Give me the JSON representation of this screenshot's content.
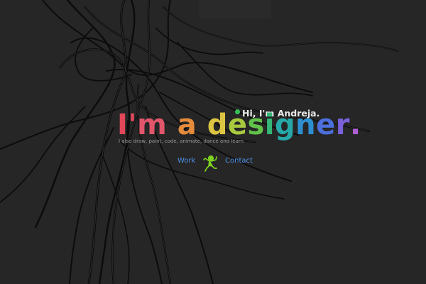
{
  "hero": {
    "greeting": "Hi, I'm Andreja.",
    "headline_letters": [
      {
        "char": "I",
        "color": "#e0485a"
      },
      {
        "char": "'",
        "color": "#e0485a"
      },
      {
        "char": "m",
        "color": "#e1566b"
      },
      {
        "char": " ",
        "color": "#ffffff"
      },
      {
        "char": "a",
        "color": "#e58b3c"
      },
      {
        "char": " ",
        "color": "#ffffff"
      },
      {
        "char": "d",
        "color": "#dcc542"
      },
      {
        "char": "e",
        "color": "#a9c93f"
      },
      {
        "char": "s",
        "color": "#62c34a"
      },
      {
        "char": "i",
        "color": "#34b676"
      },
      {
        "char": "g",
        "color": "#27a8a8"
      },
      {
        "char": "n",
        "color": "#2d8fd0"
      },
      {
        "char": "e",
        "color": "#4c6fdc"
      },
      {
        "char": "r",
        "color": "#7a61d8"
      },
      {
        "char": ".",
        "color": "#b25fd6"
      }
    ],
    "subline": "I also draw, paint, code, animate, dance and learn"
  },
  "nav": {
    "work_label": "Work",
    "contact_label": "Contact",
    "link_color": "#4f8fe6"
  },
  "icons": {
    "mascot": "dancing-figure-icon",
    "dot": "green-dot-icon"
  },
  "colors": {
    "background": "#262626",
    "mascot": "#7ed321",
    "greeting_dot": "#3bbf59"
  }
}
